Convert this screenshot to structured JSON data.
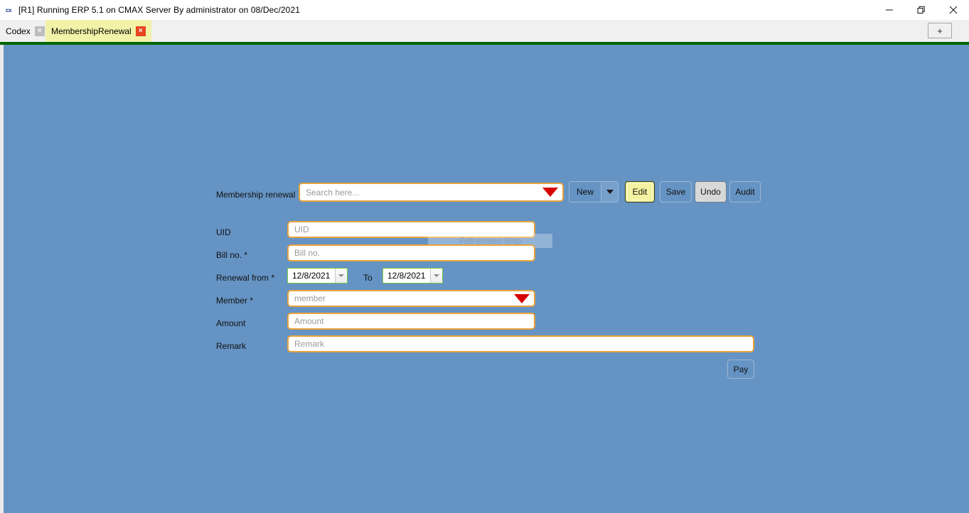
{
  "window": {
    "title": "[R1] Running ERP 5.1 on CMAX Server By administrator on 08/Dec/2021",
    "icon_glyph": "cx",
    "minimize_label": "Minimize",
    "maximize_label": "Restore",
    "close_label": "Close"
  },
  "tabs": {
    "items": [
      {
        "label": "Codex",
        "active": false,
        "close_glyph": "×"
      },
      {
        "label": "MembershipRenewal",
        "active": true,
        "close_glyph": "×"
      }
    ],
    "new_tab_glyph": "+"
  },
  "form": {
    "search_row": {
      "label": "Membership renewal",
      "placeholder": "Search here...",
      "value": ""
    },
    "toolbar": {
      "new_label": "New",
      "edit_label": "Edit",
      "save_label": "Save",
      "undo_label": "Undo",
      "audit_label": "Audit"
    },
    "fields": [
      {
        "label": "UID",
        "placeholder": "UID",
        "value": ""
      },
      {
        "label": "Bill no. *",
        "placeholder": "Bill no.",
        "value": ""
      },
      {
        "label": "Member *",
        "placeholder": "member",
        "value": ""
      },
      {
        "label": "Amount",
        "placeholder": "Amount",
        "value": ""
      },
      {
        "label": "Remark",
        "placeholder": "Remark",
        "value": ""
      }
    ],
    "date_row": {
      "label": "Renewal from *",
      "from_value": "12/8/2021",
      "to_label": "To",
      "to_value": "12/8/2021"
    },
    "pay_label": "Pay"
  },
  "overlay": {
    "snip_text": "Full-screen Snip"
  },
  "colors": {
    "canvas": "#6593c4",
    "green_divider": "#006600",
    "active_tab": "#f2f2a8",
    "field_border": "#e8a33d",
    "dropdown_red": "#d60000",
    "highlight_yellow": "#f2f2a0"
  }
}
